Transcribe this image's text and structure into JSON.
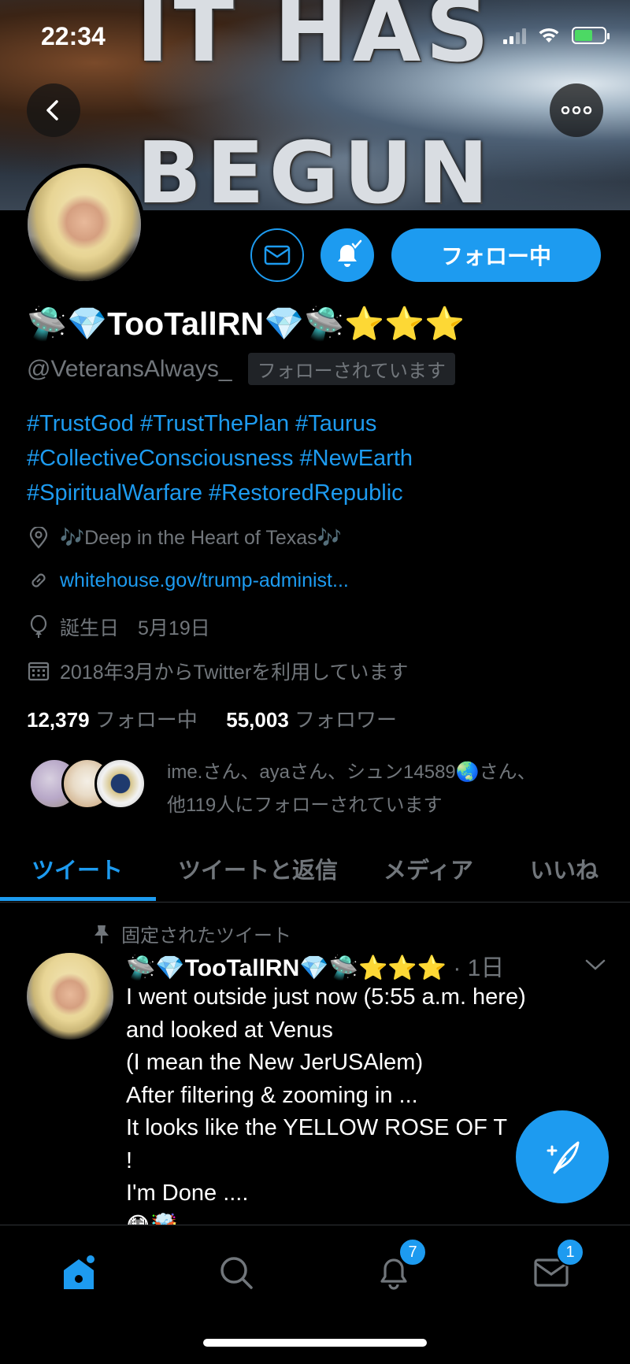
{
  "status_bar": {
    "time": "22:34"
  },
  "banner": {
    "line1": "IT HAS",
    "line2": "BEGUN"
  },
  "profile": {
    "display_name": "🛸💎TooTallRN💎🛸⭐⭐⭐",
    "handle": "@VeteransAlways_",
    "follows_you": "フォローされています",
    "follow_button": "フォロー中",
    "bio_lines": [
      "#TrustGod #TrustThePlan #Taurus",
      "#CollectiveConsciousness #NewEarth",
      "#SpiritualWarfare #RestoredRepublic"
    ],
    "location": "🎶Deep in the Heart of Texas🎶",
    "link": "whitehouse.gov/trump-administ...",
    "birthday_label": "誕生日",
    "birthday": "5月19日",
    "joined": "2018年3月からTwitterを利用しています",
    "following_count": "12,379",
    "following_label": "フォロー中",
    "followers_count": "55,003",
    "followers_label": "フォロワー",
    "mutuals_line1": "ime.さん、ayaさん、シュン14589🌏さん、",
    "mutuals_line2": "他119人にフォローされています"
  },
  "tabs": [
    {
      "label": "ツイート",
      "active": true
    },
    {
      "label": "ツイートと返信",
      "active": false
    },
    {
      "label": "メディア",
      "active": false
    },
    {
      "label": "いいね",
      "active": false
    }
  ],
  "tweet": {
    "pinned_label": "固定されたツイート",
    "author": "🛸💎TooTallRN💎🛸⭐⭐⭐",
    "time": "· 1日",
    "lines": [
      "I went outside just now (5:55 a.m. here)",
      "and looked at Venus",
      "(I mean the New JerUSAlem)",
      "After filtering & zooming in ...",
      "It looks like the YELLOW ROSE OF T",
      "!",
      "I'm Done ....",
      "😳🤯"
    ]
  },
  "bottom_nav": {
    "notifications_badge": "7",
    "messages_badge": "1"
  },
  "colors": {
    "accent": "#1d9bf0",
    "secondary_text": "#71767b",
    "background": "#000000"
  }
}
